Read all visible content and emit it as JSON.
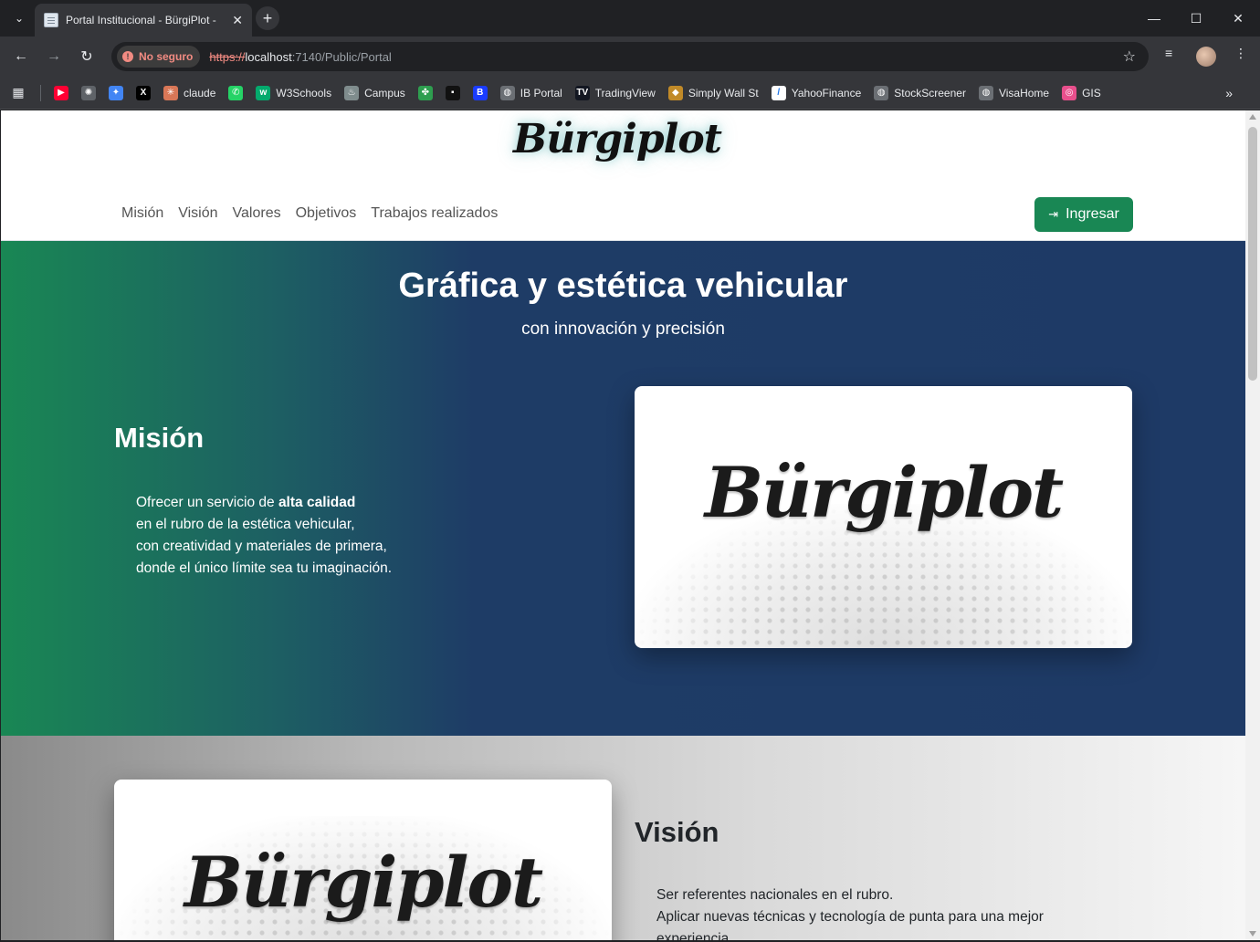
{
  "browser": {
    "tab_title": "Portal Institucional - BürgiPlot -",
    "not_secure_label": "No seguro",
    "url_proto": "https://",
    "url_host": "localhost",
    "url_path": ":7140/Public/Portal",
    "bookmarks": [
      {
        "label": "",
        "icon": "youtube-music-icon",
        "color": "#ff0033",
        "glyph": "▶"
      },
      {
        "label": "",
        "icon": "openai-icon",
        "color": "#5f6368",
        "glyph": "✺"
      },
      {
        "label": "",
        "icon": "gemini-icon",
        "color": "#4285f4",
        "glyph": "✦"
      },
      {
        "label": "",
        "icon": "x-icon",
        "color": "#000000",
        "glyph": "X"
      },
      {
        "label": "claude",
        "icon": "claude-icon",
        "color": "#d97757",
        "glyph": "✳"
      },
      {
        "label": "",
        "icon": "whatsapp-icon",
        "color": "#25d366",
        "glyph": "✆"
      },
      {
        "label": "W3Schools",
        "icon": "w3schools-icon",
        "color": "#04aa6d",
        "glyph": "w"
      },
      {
        "label": "Campus",
        "icon": "campus-icon",
        "color": "#7f8c8d",
        "glyph": "♨"
      },
      {
        "label": "",
        "icon": "clover-icon",
        "color": "#2e9e4f",
        "glyph": "✤"
      },
      {
        "label": "",
        "icon": "terminal-icon",
        "color": "#111111",
        "glyph": "▪"
      },
      {
        "label": "",
        "icon": "b-icon",
        "color": "#1a3cff",
        "glyph": "B"
      },
      {
        "label": "IB Portal",
        "icon": "globe-icon",
        "color": "#6b6f74",
        "glyph": "◍"
      },
      {
        "label": "TradingView",
        "icon": "tradingview-icon",
        "color": "#131722",
        "glyph": "TV"
      },
      {
        "label": "Simply Wall St",
        "icon": "simplywallst-icon",
        "color": "#c18a28",
        "glyph": "◆"
      },
      {
        "label": "YahooFinance",
        "icon": "yahoofinance-icon",
        "color": "#ffffff",
        "glyph": "/"
      },
      {
        "label": "StockScreener",
        "icon": "globe-icon",
        "color": "#6b6f74",
        "glyph": "◍"
      },
      {
        "label": "VisaHome",
        "icon": "globe-icon",
        "color": "#6b6f74",
        "glyph": "◍"
      },
      {
        "label": "GIS",
        "icon": "gis-icon",
        "color": "#e84f8c",
        "glyph": "◎"
      }
    ]
  },
  "site": {
    "logo_text": "Bürgiplot",
    "nav": [
      "Misión",
      "Visión",
      "Valores",
      "Objetivos",
      "Trabajos realizados"
    ],
    "login_label": "Ingresar",
    "hero_title": "Gráfica y estética vehicular",
    "hero_subtitle": "con innovación y precisión",
    "mision": {
      "heading": "Misión",
      "line1_pre": "Ofrecer un servicio de ",
      "line1_bold": "alta calidad",
      "line2": "en el rubro de la estética vehicular,",
      "line3": "con creatividad y materiales de primera,",
      "line4": "donde el único límite sea tu imaginación."
    },
    "vision": {
      "heading": "Visión",
      "line1": "Ser referentes nacionales en el rubro.",
      "line2": "Aplicar nuevas técnicas y tecnología de punta para una mejor",
      "line3": "experiencia."
    }
  }
}
